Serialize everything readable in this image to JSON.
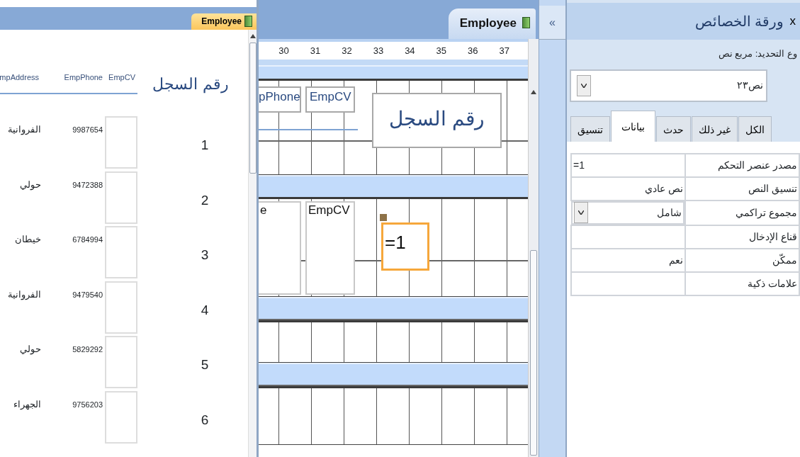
{
  "report_view": {
    "tab": {
      "label": "Employee",
      "selected": true
    },
    "columns": [
      "رقم السجل",
      "EmpCV",
      "EmpPhone",
      "mpAddress"
    ],
    "rows": [
      {
        "address": "الفروانية",
        "phone": "9987654",
        "record": "1"
      },
      {
        "address": "حولي",
        "phone": "9472388",
        "record": "2"
      },
      {
        "address": "خيطان",
        "phone": "6784994",
        "record": "3"
      },
      {
        "address": "الفروانية",
        "phone": "9479540",
        "record": "4"
      },
      {
        "address": "حولي",
        "phone": "5829292",
        "record": "5"
      },
      {
        "address": "الجهراء",
        "phone": "9756203",
        "record": "6"
      }
    ]
  },
  "design_view": {
    "tab": {
      "label": "Employee",
      "selected": true
    },
    "ruler": [
      "37",
      "36",
      "35",
      "34",
      "33",
      "32",
      "31",
      "30"
    ],
    "header_labels": [
      {
        "text": "pPhone"
      },
      {
        "text": "EmpCV"
      },
      {
        "text": "رقم السجل"
      }
    ],
    "detail_controls": [
      {
        "text": "e",
        "selected": false
      },
      {
        "text": "EmpCV",
        "selected": false
      },
      {
        "text": "=1",
        "selected": true
      }
    ]
  },
  "pane_toggle": "«",
  "property_sheet": {
    "title": "ورقة الخصائص",
    "close": "x",
    "selection_type": "وع التحديد:  مربع نص",
    "object": "نص٢٣",
    "tabs": [
      {
        "label": "الكل",
        "selected": false
      },
      {
        "label": "غير ذلك",
        "selected": false
      },
      {
        "label": "حدث",
        "selected": false
      },
      {
        "label": "بيانات",
        "selected": true
      },
      {
        "label": "تنسيق",
        "selected": false
      }
    ],
    "properties": [
      {
        "name": "مصدر عنصر التحكم",
        "value": "=1",
        "kind": "expression"
      },
      {
        "name": "تنسيق النص",
        "value": "نص عادي",
        "kind": "text"
      },
      {
        "name": "مجموع تراكمي",
        "value": "شامل",
        "kind": "dropdown"
      },
      {
        "name": "قناع الإدخال",
        "kind": "text"
      },
      {
        "name": "ممكّن",
        "value": "نعم",
        "kind": "text"
      },
      {
        "name": "علامات ذكية",
        "kind": "text"
      }
    ]
  }
}
